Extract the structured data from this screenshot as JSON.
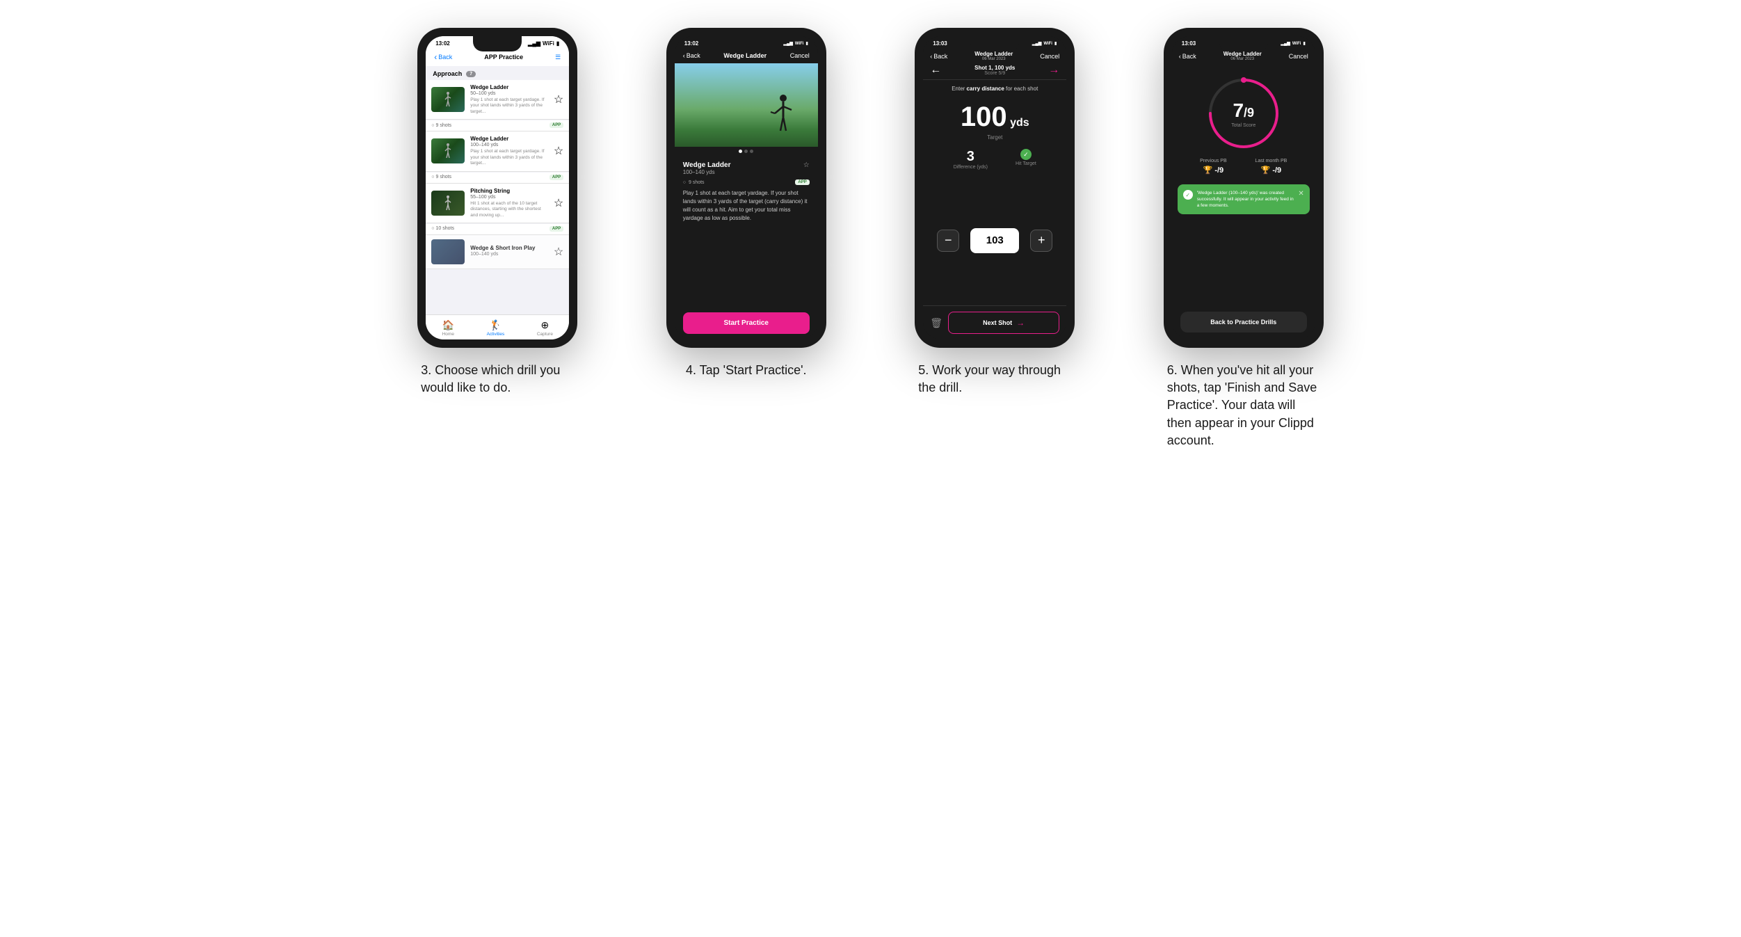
{
  "phones": [
    {
      "id": "phone1",
      "status_time": "13:02",
      "theme": "light",
      "nav": {
        "back": "Back",
        "title": "APP Practice",
        "right": "☰"
      },
      "section": "Approach",
      "section_count": "7",
      "drills": [
        {
          "name": "Wedge Ladder",
          "range": "50–100 yds",
          "desc": "Play 1 shot at each target yardage. If your shot lands within 3 yards of the target...",
          "shots": "9 shots",
          "badge": "APP"
        },
        {
          "name": "Wedge Ladder",
          "range": "100–140 yds",
          "desc": "Play 1 shot at each target yardage. If your shot lands within 3 yards of the target...",
          "shots": "9 shots",
          "badge": "APP"
        },
        {
          "name": "Pitching String",
          "range": "55–100 yds",
          "desc": "Hit 1 shot at each of the 10 target distances, starting with the shortest and moving up...",
          "shots": "10 shots",
          "badge": "APP"
        },
        {
          "name": "Wedge & Short Iron Play",
          "range": "100–140 yds",
          "desc": "",
          "shots": "",
          "badge": ""
        }
      ],
      "tabs": [
        {
          "label": "Home",
          "icon": "🏠",
          "active": false
        },
        {
          "label": "Activities",
          "icon": "🏌",
          "active": true
        },
        {
          "label": "Capture",
          "icon": "⊕",
          "active": false
        }
      ]
    },
    {
      "id": "phone2",
      "status_time": "13:02",
      "theme": "dark",
      "nav": {
        "back": "Back",
        "title": "Wedge Ladder",
        "right": "Cancel"
      },
      "hero_alt": "Golfer on course",
      "dots": [
        true,
        false,
        false
      ],
      "drill": {
        "name": "Wedge Ladder",
        "range": "100–140 yds",
        "shots": "9 shots",
        "badge": "APP",
        "desc": "Play 1 shot at each target yardage. If your shot lands within 3 yards of the target (carry distance) it will count as a hit. Aim to get your total miss yardage as low as possible."
      },
      "start_btn": "Start Practice"
    },
    {
      "id": "phone3",
      "status_time": "13:03",
      "theme": "dark",
      "nav": {
        "back": "Back",
        "title": "Wedge Ladder",
        "subtitle": "06 Mar 2023",
        "right": "Cancel"
      },
      "shot_label": "Shot 1, 100 yds",
      "score_label": "Score 5/9",
      "instruction": "Enter carry distance for each shot",
      "target_distance": "100",
      "target_unit": "yds",
      "target_label": "Target",
      "difference": "3",
      "difference_label": "Difference (yds)",
      "hit_target": "Hit Target",
      "input_value": "103",
      "next_shot": "Next Shot"
    },
    {
      "id": "phone4",
      "status_time": "13:03",
      "theme": "dark",
      "nav": {
        "back": "Back",
        "title": "Wedge Ladder",
        "subtitle": "06 Mar 2023",
        "right": "Cancel"
      },
      "score": "7",
      "score_denom": "/9",
      "score_label": "Total Score",
      "previous_pb_label": "Previous PB",
      "previous_pb_value": "-/9",
      "last_month_pb_label": "Last month PB",
      "last_month_pb_value": "-/9",
      "toast": "'Wedge Ladder (100–140 yds)' was created successfully. It will appear in your activity feed in a few moments.",
      "back_btn": "Back to Practice Drills",
      "circle_progress": 77
    }
  ],
  "captions": [
    "3. Choose which drill you would like to do.",
    "4. Tap 'Start Practice'.",
    "5. Work your way through the drill.",
    "6. When you've hit all your shots, tap 'Finish and Save Practice'. Your data will then appear in your Clippd account."
  ]
}
